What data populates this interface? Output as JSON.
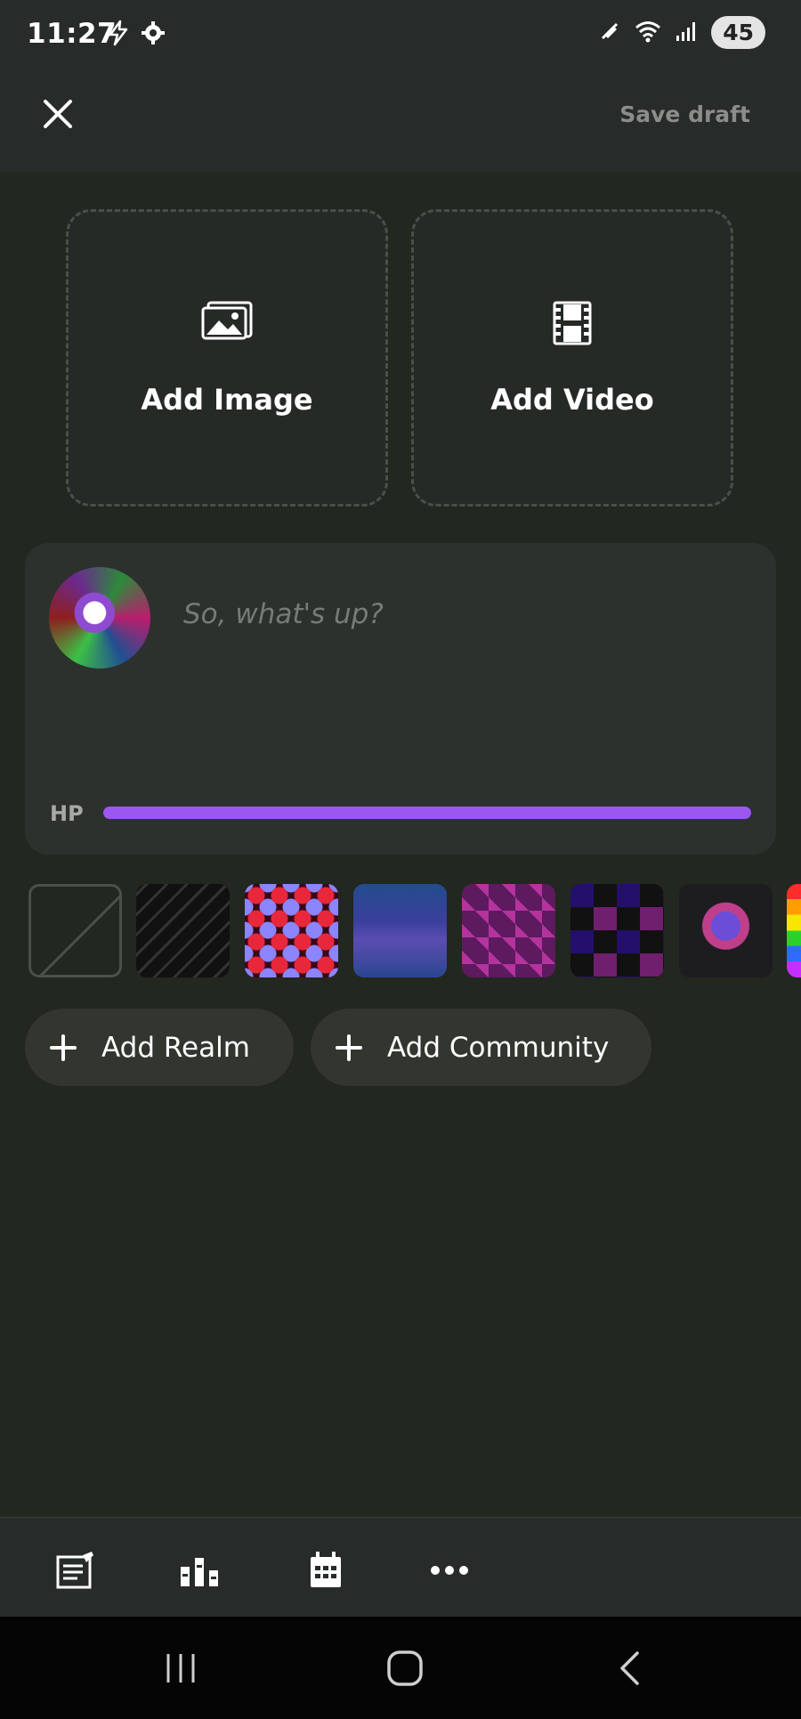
{
  "status_bar": {
    "time": "11:27",
    "battery": "45"
  },
  "top_bar": {
    "save_draft_label": "Save draft"
  },
  "media": {
    "add_image_label": "Add Image",
    "add_video_label": "Add Video"
  },
  "compose": {
    "placeholder": "So, what's up?",
    "hp_label": "HP",
    "hp_fraction": 1.0,
    "hp_color": "#9b57f2"
  },
  "backgrounds": [
    {
      "name": "none"
    },
    {
      "name": "black-waves"
    },
    {
      "name": "hearts"
    },
    {
      "name": "blue-clouds"
    },
    {
      "name": "pink-diamonds"
    },
    {
      "name": "checker-cats"
    },
    {
      "name": "dark-character"
    },
    {
      "name": "rainbow"
    }
  ],
  "chips": {
    "add_realm_label": "Add Realm",
    "add_community_label": "Add Community"
  },
  "toolbar": {
    "items": [
      "post-type-icon",
      "poll-icon",
      "calendar-icon",
      "more-icon"
    ]
  },
  "colors": {
    "background": "#222720",
    "surface": "#2d312e",
    "accent": "#9b57f2"
  }
}
